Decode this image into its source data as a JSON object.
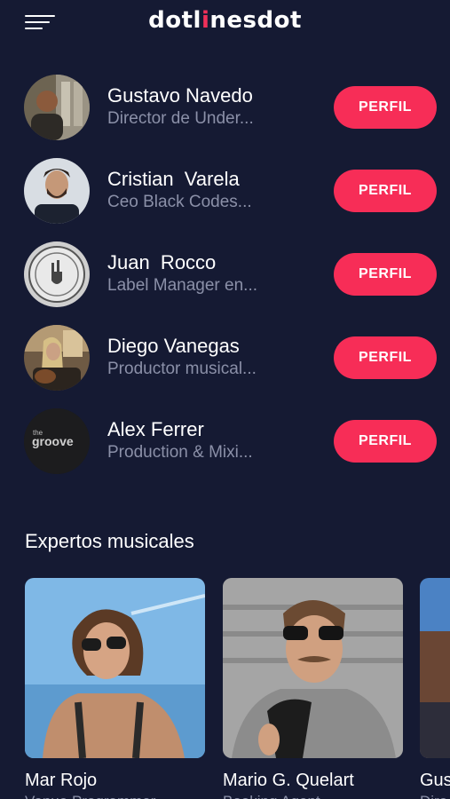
{
  "header": {
    "logo_part1": "dotl",
    "logo_dot": "i",
    "logo_part2": "nesdot",
    "menu_icon": "hamburger-menu-icon"
  },
  "people": [
    {
      "name": "Gustavo Navedo",
      "role": "Director de Under...",
      "button": "PERFIL"
    },
    {
      "name": "Cristian  Varela",
      "role": "Ceo Black Codes...",
      "button": "PERFIL"
    },
    {
      "name": "Juan  Rocco",
      "role": "Label Manager en...",
      "button": "PERFIL"
    },
    {
      "name": "Diego Vanegas",
      "role": "Productor musical...",
      "button": "PERFIL"
    },
    {
      "name": "Alex Ferrer",
      "role": "Production & Mixi...",
      "button": "PERFIL",
      "avatar_text": "the groove"
    }
  ],
  "experts": {
    "title": "Expertos musicales",
    "cards": [
      {
        "name": "Mar Rojo",
        "role": "Venue Programmer"
      },
      {
        "name": "Mario G. Quelart",
        "role": "Booking Agent"
      },
      {
        "name": "Gus",
        "role": "Dire"
      }
    ]
  },
  "colors": {
    "background": "#151a33",
    "accent": "#f72d57",
    "muted_text": "#8b90a8"
  }
}
